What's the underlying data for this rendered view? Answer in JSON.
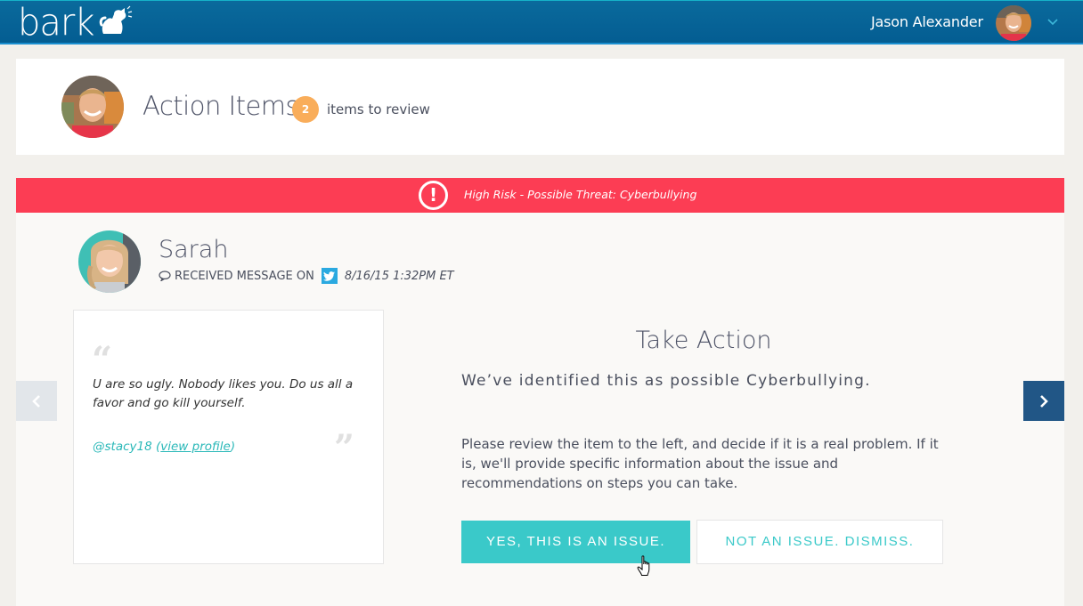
{
  "app": {
    "brand": "bark"
  },
  "nav": {
    "user_name": "Jason Alexander",
    "menu_icon": "chevron-down-icon"
  },
  "header": {
    "title": "Action Items",
    "count": "2",
    "count_label": "items to review"
  },
  "alert": {
    "icon": "exclamation-circle-icon",
    "text": "High Risk - Possible Threat: Cyberbullying",
    "color": "#fc3d54"
  },
  "item": {
    "child_name": "Sarah",
    "received_label": "RECEIVED MESSAGE ON",
    "platform_icon": "twitter-icon",
    "timestamp": "8/16/15 1:32PM ET",
    "message": {
      "open_quote": "“",
      "close_quote": "”",
      "text": "U are so ugly.  Nobody likes you.  Do us all a favor and go kill yourself.",
      "author": "@stacy18",
      "paren_open": " (",
      "profile_link": "view profile",
      "paren_close": ")"
    }
  },
  "take_action": {
    "title": "Take Action",
    "subtitle": "We’ve identified this as possible Cyberbullying.",
    "description": "Please review the item to the left, and decide if it is a real problem. If it is, we'll provide specific information about the issue and recommendations on steps you can take.",
    "yes_button": "YES, THIS IS AN ISSUE.",
    "no_button": "NOT AN ISSUE.  DISMISS."
  },
  "colors": {
    "nav_bg": "#045d92",
    "accent_teal": "#3ac9c9",
    "badge_orange": "#f9ad5a",
    "next_arrow_bg": "#215686",
    "twitter_blue": "#2aa9e0"
  }
}
